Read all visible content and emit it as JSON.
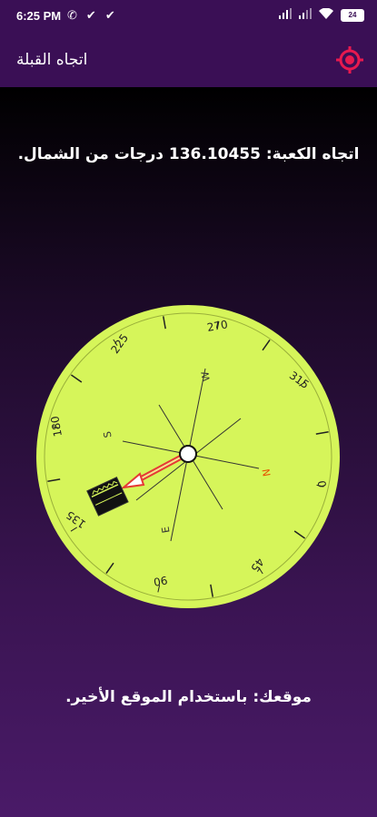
{
  "status_bar": {
    "time": "6:25 PM",
    "battery": "24"
  },
  "app_bar": {
    "title": "اتجاه القبلة"
  },
  "qibla": {
    "text": "اتجاه الكعبة: 136.10455 درجات من الشمال."
  },
  "location": {
    "text": "موقعك: باستخدام الموقع الأخير."
  },
  "compass": {
    "face_color": "#d6f55a",
    "heading_degrees": 136.10455,
    "degree_labels": [
      "270",
      "315",
      "0",
      "45",
      "90",
      "135",
      "180",
      "225"
    ],
    "cardinal_labels": [
      "W",
      "N",
      "E",
      "S"
    ]
  },
  "colors": {
    "app_bar": "#3a0f55",
    "locate_icon": "#e8194f",
    "arrow": "#e53935"
  }
}
